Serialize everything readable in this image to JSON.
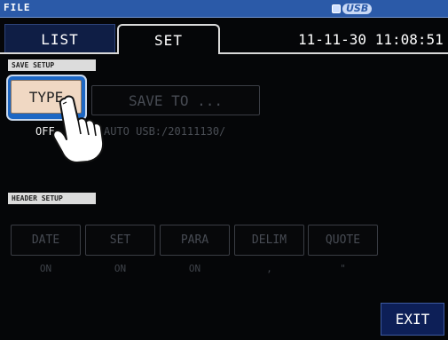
{
  "window": {
    "title": "FILE"
  },
  "status": {
    "usb_label": "USB"
  },
  "tabs": [
    {
      "label": "LIST",
      "selected": false
    },
    {
      "label": "SET",
      "selected": true
    }
  ],
  "datetime": "11-11-30 11:08:51",
  "save_setup": {
    "heading": "SAVE SETUP",
    "type_button_label": "TYPE",
    "type_value": "OFF",
    "save_to_button_label": "SAVE TO ...",
    "save_to_value": "AUTO  USB:/20111130/"
  },
  "header_setup": {
    "heading": "HEADER SETUP",
    "items": [
      {
        "label": "DATE",
        "value": "ON"
      },
      {
        "label": "SET",
        "value": "ON"
      },
      {
        "label": "PARA",
        "value": "ON"
      },
      {
        "label": "DELIM",
        "value": ","
      },
      {
        "label": "QUOTE",
        "value": "\""
      }
    ]
  },
  "exit_label": "EXIT",
  "colors": {
    "titlebar": "#2b5aa8",
    "background": "#050608",
    "selected_button": "#f0d8c3",
    "exit_button": "#0d1f57"
  }
}
